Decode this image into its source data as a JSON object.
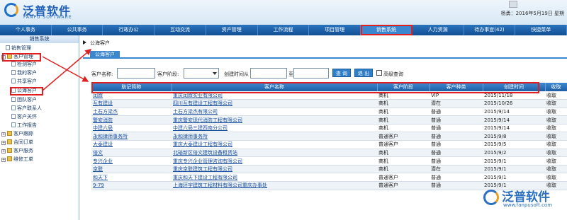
{
  "brand": {
    "cn": "泛普软件",
    "en": "FANPU SOFTWARE"
  },
  "userinfo": "杨勇：2016年5月19日 星期",
  "nav": [
    "个人事务",
    "公共事务",
    "行政办公",
    "互动交流",
    "资产管理",
    "工作流程",
    "项目管理",
    "销售系统",
    "人力资源",
    "待办事宜(42)",
    "快捷菜单"
  ],
  "nav_highlight": "销售系统",
  "sidebar": {
    "title": "销售系统",
    "items": [
      "销售管理",
      "客户管理",
      "检测客户",
      "我的客户",
      "共享客户",
      "公海客户",
      "团队客户",
      "客户联系人",
      "客户关怀",
      "工作报告",
      "客户跟踪",
      "合同订单",
      "客户服务",
      "维修工单"
    ]
  },
  "breadcrumb": "公海客户",
  "tab": "公海客户",
  "search": {
    "name_label": "客户名称:",
    "stage_label": "客户阶段:",
    "created_label": "创建时间从",
    "to_label": "至",
    "query_btn": "查 询",
    "exit_btn": "退 出",
    "advanced_label": "高级查询"
  },
  "table": {
    "headers": [
      "助记简称",
      "客户名称",
      "客户阶段",
      "客户种类",
      "创建时间",
      "收取"
    ],
    "rows": [
      [
        "闰霖",
        "重庆闰霖实业有限公司",
        "商机",
        "VIP",
        "2015/11/18",
        "收取"
      ],
      [
        "互有建设",
        "四川互有建设工程有限公司",
        "商机",
        "潜在",
        "2015/10/26",
        "收取"
      ],
      [
        "土石方梁杰",
        "土石方梁杰有限公司",
        "商机",
        "普通",
        "2015/9/14",
        "收取"
      ],
      [
        "警安消防",
        "重庆警安现代消防工程有限公司",
        "商机",
        "普通",
        "2015/9/14",
        "收取"
      ],
      [
        "中建六局",
        "中建六局三建西南分公司",
        "商机",
        "普通",
        "2015/9/14",
        "收取"
      ],
      [
        "永和律师事务所",
        "永和律师事务所",
        "普通客户",
        "普通",
        "2015/9/8",
        "收取"
      ],
      [
        "大泰建设",
        "重庆大泰建设工程有限公司",
        "普通客户",
        "普通",
        "2015/9/5",
        "收取"
      ],
      [
        "倍文",
        "北碚新区倍文建筑设备租赁站",
        "商机",
        "普通",
        "2015/9/2",
        "收取"
      ],
      [
        "专兴企业",
        "重庆专兴企业管理咨询有限公司",
        "商机",
        "普通",
        "2015/9/1",
        "收取"
      ],
      [
        "京联",
        "重庆京联建筑工程有限公司",
        "商机",
        "潜在",
        "2015/9/1",
        "收取"
      ],
      [
        "和天下",
        "重庆和天下建设工程有限公司",
        "普通客户",
        "普通",
        "2015/9/1",
        "收取"
      ],
      [
        "9-79",
        "上海环宇建筑工程材料有限公司重庆办事处",
        "普通客户",
        "普通",
        "2015/9/1",
        "收取"
      ]
    ]
  },
  "watermark": {
    "name": "泛普软件",
    "url": "www.fanpusoft.com"
  },
  "colors": {
    "nav": "#1d5ea5",
    "accent": "#3a86cf",
    "highlight": "#e02020"
  }
}
